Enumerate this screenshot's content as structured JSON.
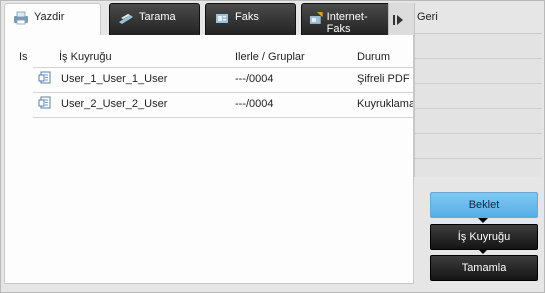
{
  "tabs": [
    {
      "label": "Yazdir",
      "icon": "printer-icon",
      "active": true
    },
    {
      "label": "Tarama",
      "icon": "scanner-icon",
      "active": false
    },
    {
      "label": "Faks",
      "icon": "fax-icon",
      "active": false
    },
    {
      "label": "Internet-Faks",
      "icon": "internet-fax-icon",
      "active": false
    }
  ],
  "table": {
    "headers": {
      "is": "Is",
      "queue": "İş Kuyruğu",
      "progress": "Ilerle / Gruplar",
      "status": "Durum"
    },
    "rows": [
      {
        "name": "User_1_User_1_User",
        "progress": "---/0004",
        "status": "Şifreli PDF"
      },
      {
        "name": "User_2_User_2_User",
        "progress": "---/0004",
        "status": "Kuyruklama"
      }
    ]
  },
  "side": {
    "back_label": "Geri"
  },
  "actions": {
    "hold": "Beklet",
    "job_queue": "İş Kuyruğu",
    "complete": "Tamamla"
  },
  "colors": {
    "active_button": "#6bbcee",
    "dark_button": "#1f1f1f"
  }
}
